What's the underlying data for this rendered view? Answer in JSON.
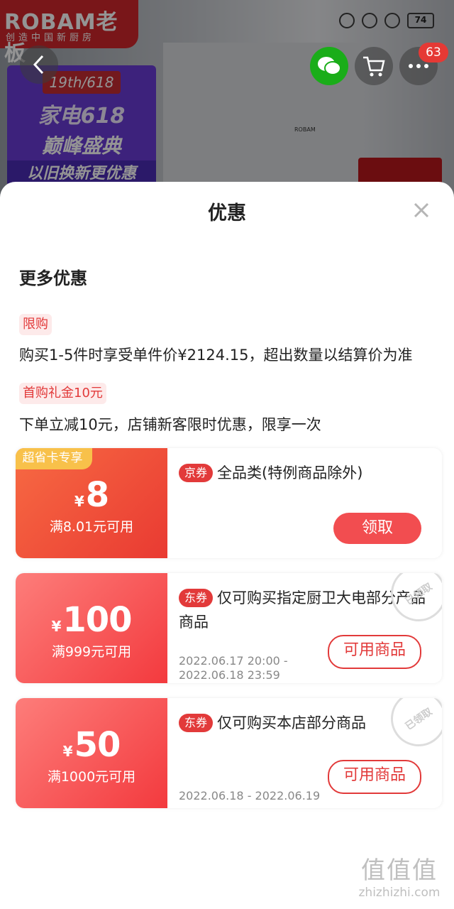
{
  "background": {
    "brand_name": "ROBAM老板",
    "brand_slogan": "创造中国新厨房",
    "promo_tag": "19th/618",
    "promo_line1": "家电618",
    "promo_line2": "巅峰盛典",
    "promo_line3": "以旧换新更优惠",
    "fridge_label": "ROBAM",
    "battery": "74",
    "cart_badge": "63"
  },
  "sheet": {
    "title": "优惠",
    "section_title": "更多优惠",
    "limit_tag": "限购",
    "limit_desc": "购买1-5件时享受单件价¥2124.15，超出数量以结算价为准",
    "gift_tag": "首购礼金10元",
    "gift_desc": "下单立减10元，店铺新客限时优惠，限享一次"
  },
  "coupons": [
    {
      "special_tag": "超省卡专享",
      "currency": "¥",
      "amount": "8",
      "condition": "满8.01元可用",
      "type": "京券",
      "title": "全品类(特例商品除外)",
      "date": "",
      "button": "领取"
    },
    {
      "currency": "¥",
      "amount": "100",
      "condition": "满999元可用",
      "type": "东券",
      "title": "仅可购买指定厨卫大电部分产品商品",
      "date": "2022.06.17 20:00 - 2022.06.18 23:59",
      "button": "可用商品",
      "stamp": "已领取"
    },
    {
      "currency": "¥",
      "amount": "50",
      "condition": "满1000元可用",
      "type": "东券",
      "title": "仅可购买本店部分商品",
      "date": "2022.06.18 - 2022.06.19",
      "button": "可用商品",
      "stamp": "已领取"
    }
  ],
  "watermark": {
    "logo": "值值值",
    "text": "zhizhizhi.com"
  },
  "colors": {
    "accent": "#e23a3a",
    "coupon_orange": "#f76a43",
    "coupon_red": "#f33a3e",
    "special_tag": "#f8c14a",
    "wechat": "#1aad19"
  }
}
